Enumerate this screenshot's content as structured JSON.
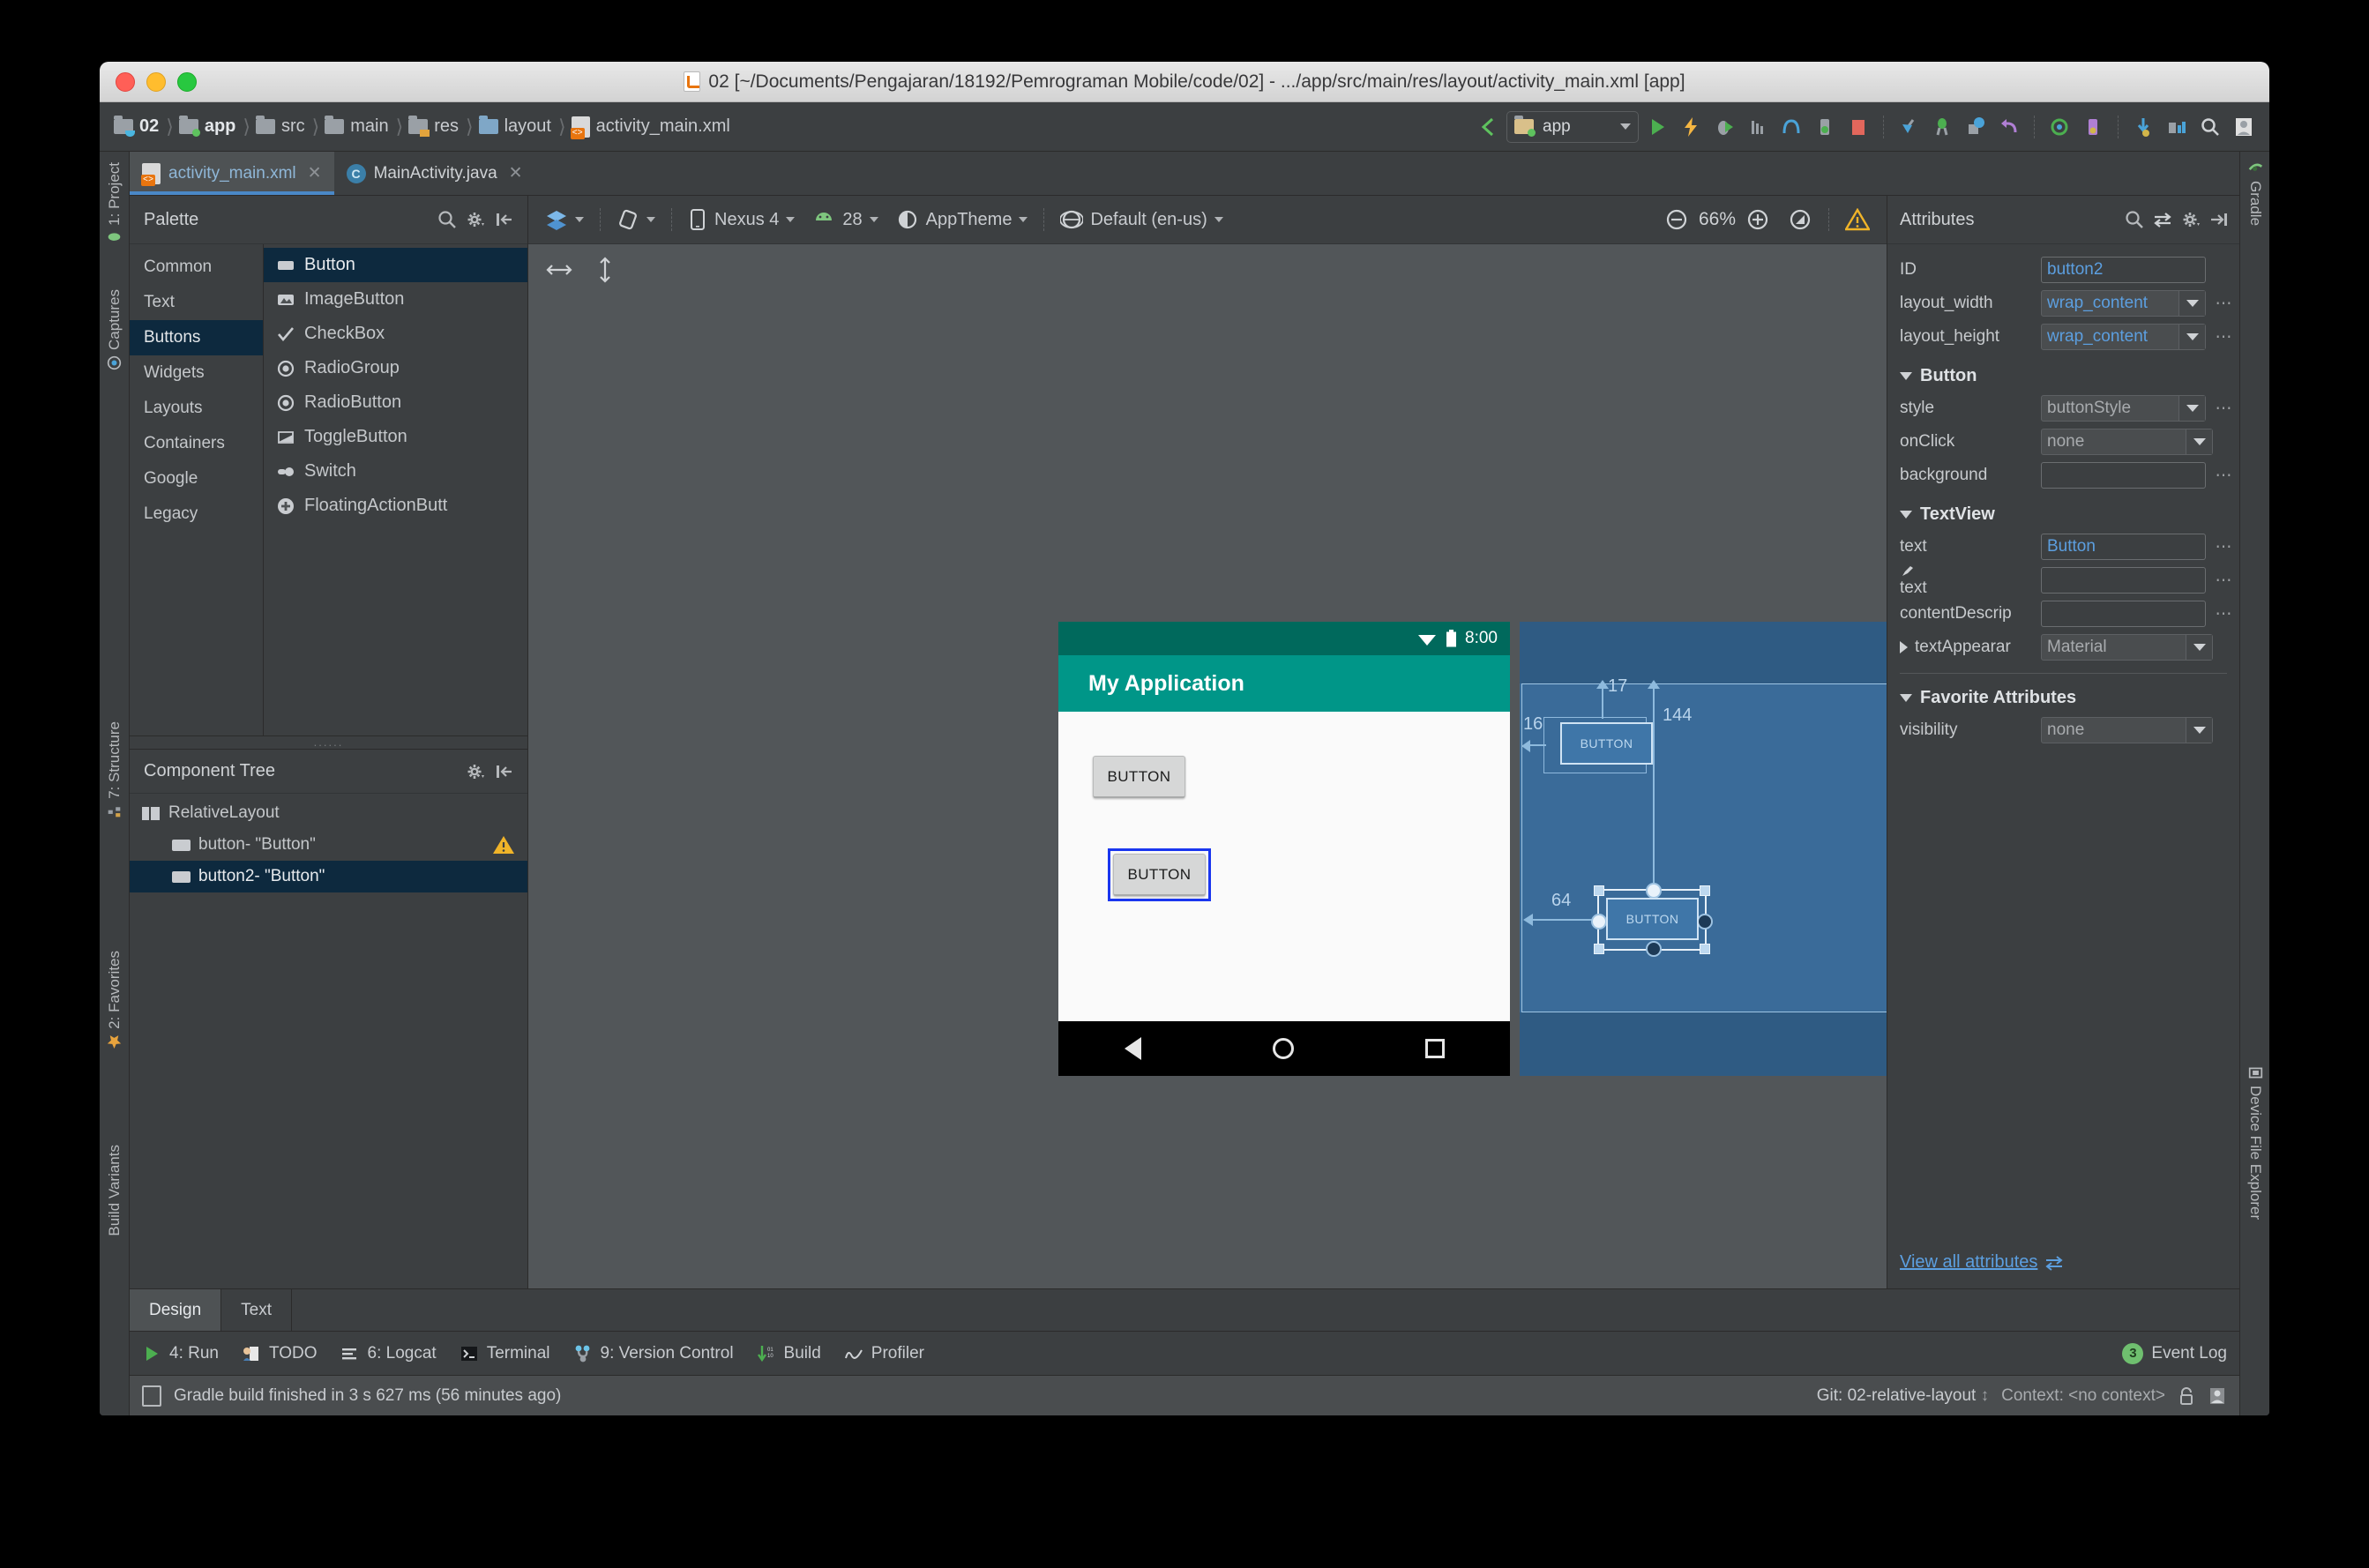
{
  "window": {
    "title": "02 [~/Documents/Pengajaran/18192/Pemrograman Mobile/code/02] - .../app/src/main/res/layout/activity_main.xml [app]"
  },
  "navbar": {
    "crumbs": [
      {
        "label": "02",
        "icon": "folder-java-icon"
      },
      {
        "label": "app",
        "icon": "folder-module-icon"
      },
      {
        "label": "src",
        "icon": "folder-icon"
      },
      {
        "label": "main",
        "icon": "folder-icon"
      },
      {
        "label": "res",
        "icon": "folder-res-icon"
      },
      {
        "label": "layout",
        "icon": "folder-layout-icon"
      },
      {
        "label": "activity_main.xml",
        "icon": "xml-file-icon"
      }
    ],
    "separator": "〉",
    "run_config": "app",
    "icons": [
      "back-icon",
      "run-icon",
      "apply-changes-icon",
      "debug-icon",
      "profile-icon",
      "avd-manager-icon",
      "sdk-manager-icon",
      "stop-icon",
      "step-into-icon",
      "attach-debugger-icon",
      "layout-inspector-icon",
      "undo-icon",
      "sync-gradle-icon",
      "avd-icon",
      "install-icon",
      "project-structure-icon",
      "search-everywhere-icon",
      "user-icon"
    ]
  },
  "left_rail": [
    {
      "label": "1: Project",
      "icon": "android-icon"
    },
    {
      "label": "Captures",
      "icon": "captures-icon"
    },
    {
      "label": "7: Structure",
      "icon": "structure-icon"
    },
    {
      "label": "2: Favorites",
      "icon": "star-icon"
    },
    {
      "label": "Build Variants",
      "icon": ""
    }
  ],
  "right_rail": [
    {
      "label": "Gradle",
      "icon": "gradle-icon"
    },
    {
      "label": "Device File Explorer",
      "icon": "device-icon"
    }
  ],
  "editor_tabs": [
    {
      "label": "activity_main.xml",
      "icon": "xml-layout-icon",
      "active": true
    },
    {
      "label": "MainActivity.java",
      "icon": "java-class-icon",
      "active": false
    }
  ],
  "palette": {
    "title": "Palette",
    "actions": [
      "search-icon",
      "gear-icon",
      "collapse-icon"
    ],
    "categories": [
      {
        "label": "Common",
        "selected": false
      },
      {
        "label": "Text",
        "selected": false
      },
      {
        "label": "Buttons",
        "selected": true
      },
      {
        "label": "Widgets",
        "selected": false
      },
      {
        "label": "Layouts",
        "selected": false
      },
      {
        "label": "Containers",
        "selected": false
      },
      {
        "label": "Google",
        "selected": false
      },
      {
        "label": "Legacy",
        "selected": false
      }
    ],
    "items": [
      {
        "label": "Button",
        "icon": "button-icon",
        "selected": true
      },
      {
        "label": "ImageButton",
        "icon": "image-button-icon",
        "selected": false
      },
      {
        "label": "CheckBox",
        "icon": "checkbox-icon",
        "selected": false
      },
      {
        "label": "RadioGroup",
        "icon": "radio-group-icon",
        "selected": false
      },
      {
        "label": "RadioButton",
        "icon": "radio-button-icon",
        "selected": false
      },
      {
        "label": "ToggleButton",
        "icon": "toggle-button-icon",
        "selected": false
      },
      {
        "label": "Switch",
        "icon": "switch-icon",
        "selected": false
      },
      {
        "label": "FloatingActionButt",
        "icon": "fab-icon",
        "selected": false
      }
    ]
  },
  "component_tree": {
    "title": "Component Tree",
    "actions": [
      "gear-icon",
      "collapse-icon"
    ],
    "nodes": [
      {
        "label": "RelativeLayout",
        "icon": "relative-layout-icon",
        "indent": 0,
        "selected": false,
        "warning": false
      },
      {
        "label": "button- \"Button\"",
        "icon": "button-icon",
        "indent": 1,
        "selected": false,
        "warning": true
      },
      {
        "label": "button2- \"Button\"",
        "icon": "button-icon",
        "indent": 1,
        "selected": true,
        "warning": false
      }
    ]
  },
  "design_toolbar": {
    "view_mode_icon": "layers-icon",
    "orientation_icon": "rotate-icon",
    "device": "Nexus 4",
    "api_level": "28",
    "theme": "AppTheme",
    "locale": "Default (en-us)",
    "zoom": "66%",
    "zoom_out_icon": "zoom-out-icon",
    "zoom_in_icon": "zoom-in-icon",
    "zoom_fit_icon": "zoom-fit-icon",
    "warning_icon": "warning-icon"
  },
  "canvas_tools": [
    "pan-horizontal-icon",
    "pan-vertical-icon"
  ],
  "preview": {
    "status_time": "8:00",
    "status_icons": [
      "wifi-icon",
      "battery-icon"
    ],
    "app_title": "My Application",
    "buttons": [
      {
        "label": "BUTTON",
        "id": "button",
        "selected": false
      },
      {
        "label": "BUTTON",
        "id": "button2",
        "selected": true
      }
    ],
    "nav_icons": [
      "back-icon",
      "home-icon",
      "recents-icon"
    ]
  },
  "blueprint": {
    "buttons": [
      {
        "label": "BUTTON",
        "id": "button"
      },
      {
        "label": "BUTTON",
        "id": "button2"
      }
    ],
    "measurements": [
      {
        "value": "17",
        "axis": "top"
      },
      {
        "value": "16",
        "axis": "left"
      },
      {
        "value": "144",
        "axis": "vertical"
      },
      {
        "value": "64",
        "axis": "horizontal"
      }
    ]
  },
  "attributes": {
    "title": "Attributes",
    "actions": [
      "search-icon",
      "swap-icon",
      "gear-icon",
      "collapse-icon"
    ],
    "top_rows": [
      {
        "key": "ID",
        "value": "button2",
        "kind": "text",
        "value_style": "blue",
        "more": false
      },
      {
        "key": "layout_width",
        "value": "wrap_content",
        "kind": "combo",
        "value_style": "blue",
        "more": true
      },
      {
        "key": "layout_height",
        "value": "wrap_content",
        "kind": "combo",
        "value_style": "blue",
        "more": true
      }
    ],
    "sections": [
      {
        "title": "Button",
        "expanded": true,
        "rows": [
          {
            "key": "style",
            "value": "buttonStyle",
            "kind": "combo",
            "value_style": "dim",
            "more": true
          },
          {
            "key": "onClick",
            "value": "none",
            "kind": "combo-wide",
            "value_style": "dim",
            "more": false
          },
          {
            "key": "background",
            "value": "",
            "kind": "text",
            "value_style": "plain",
            "more": true
          }
        ]
      },
      {
        "title": "TextView",
        "expanded": true,
        "rows": [
          {
            "key": "text",
            "value": "Button",
            "kind": "text",
            "value_style": "blue",
            "more": true
          },
          {
            "key": "text",
            "value": "",
            "kind": "text",
            "value_style": "plain",
            "more": true,
            "icon": "brush-icon"
          },
          {
            "key": "contentDescrip",
            "value": "",
            "kind": "text",
            "value_style": "plain",
            "more": true
          },
          {
            "key": "textAppearar",
            "value": "Material",
            "kind": "combo-wide",
            "value_style": "dim",
            "more": false,
            "collapsed": true
          }
        ]
      },
      {
        "title": "Favorite Attributes",
        "expanded": true,
        "rows": [
          {
            "key": "visibility",
            "value": "none",
            "kind": "combo-wide",
            "value_style": "dim",
            "more": false
          }
        ]
      }
    ],
    "view_all_label": "View all attributes",
    "view_all_icon": "swap-icon"
  },
  "design_tabs": [
    {
      "label": "Design",
      "active": true,
      "mnemonic": "D"
    },
    {
      "label": "Text",
      "active": false,
      "mnemonic": "T"
    }
  ],
  "status_strip": {
    "items": [
      {
        "label": "4: Run",
        "icon": "run-icon",
        "underline": "4"
      },
      {
        "label": "TODO",
        "icon": "todo-icon",
        "underline": ""
      },
      {
        "label": "6: Logcat",
        "icon": "logcat-icon",
        "underline": "6"
      },
      {
        "label": "Terminal",
        "icon": "terminal-icon",
        "underline": ""
      },
      {
        "label": "9: Version Control",
        "icon": "vcs-icon",
        "underline": "9"
      },
      {
        "label": "Build",
        "icon": "build-icon",
        "underline": ""
      },
      {
        "label": "Profiler",
        "icon": "profiler-icon",
        "underline": ""
      }
    ],
    "event_log": "Event Log",
    "event_count": "3"
  },
  "bottom_bar": {
    "message": "Gradle build finished in 3 s 627 ms (56 minutes ago)",
    "git": "Git: 02-relative-layout",
    "context": "Context: <no context>",
    "icons": [
      "lock-icon",
      "user-icon",
      "memory-icon"
    ]
  },
  "colors": {
    "accent_blue": "#5c9fe0",
    "selection_blue": "#0d293e",
    "teal": "#009688",
    "teal_dark": "#00695c",
    "panel_bg": "#3c3f41",
    "canvas_bg": "#525659",
    "blueprint_bg": "#3a6b99",
    "warning_yellow": "#f0b429"
  }
}
